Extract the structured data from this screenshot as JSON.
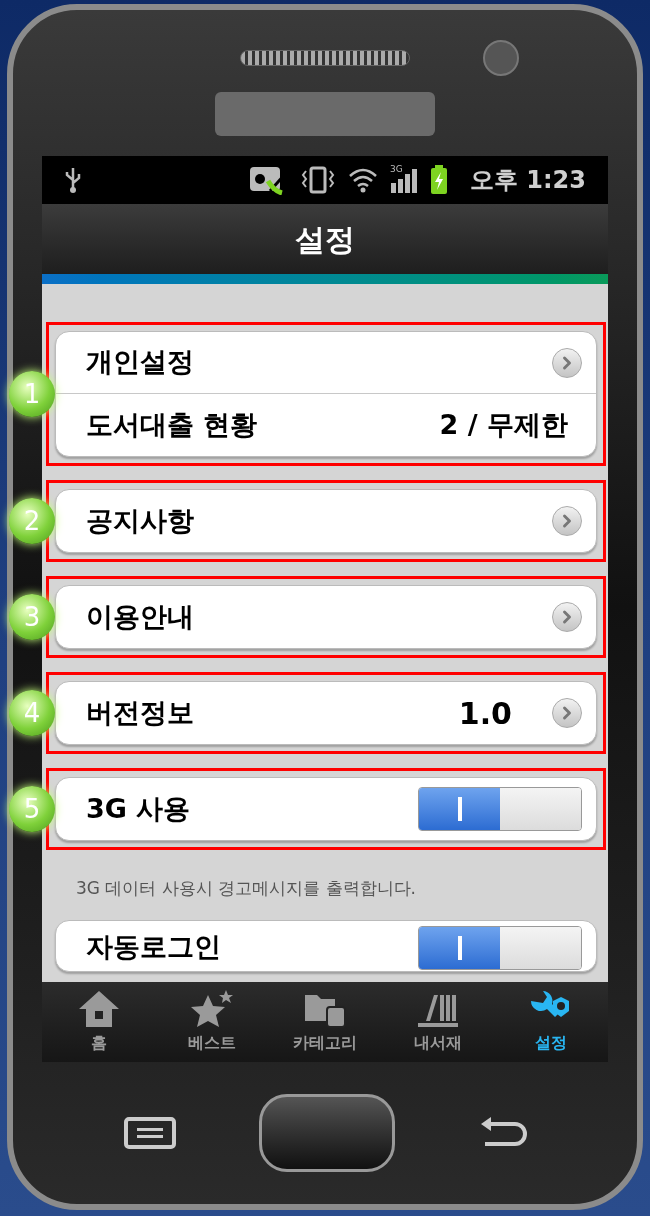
{
  "status_bar": {
    "signal_label": "3G",
    "time": "오후 1:23"
  },
  "title": "설정",
  "sections": [
    {
      "callout": "1",
      "rows": [
        {
          "kind": "link",
          "label": "개인설정"
        },
        {
          "kind": "value",
          "label": "도서대출 현황",
          "value": "2 / 무제한"
        }
      ]
    },
    {
      "callout": "2",
      "rows": [
        {
          "kind": "link",
          "label": "공지사항"
        }
      ]
    },
    {
      "callout": "3",
      "rows": [
        {
          "kind": "link",
          "label": "이용안내"
        }
      ]
    },
    {
      "callout": "4",
      "rows": [
        {
          "kind": "link",
          "label": "버전정보",
          "value": "1.0"
        }
      ]
    },
    {
      "callout": "5",
      "rows": [
        {
          "kind": "toggle",
          "label": "3G 사용",
          "on": true
        }
      ]
    },
    {
      "note": "3G 데이터 사용시 경고메시지를 출력합니다.",
      "rows": [
        {
          "kind": "toggle",
          "label": "자동로그인",
          "on": true
        }
      ]
    }
  ],
  "tabs": [
    {
      "label": "홈",
      "selected": false
    },
    {
      "label": "베스트",
      "selected": false
    },
    {
      "label": "카테고리",
      "selected": false
    },
    {
      "label": "내서재",
      "selected": false
    },
    {
      "label": "설정",
      "selected": true
    }
  ]
}
